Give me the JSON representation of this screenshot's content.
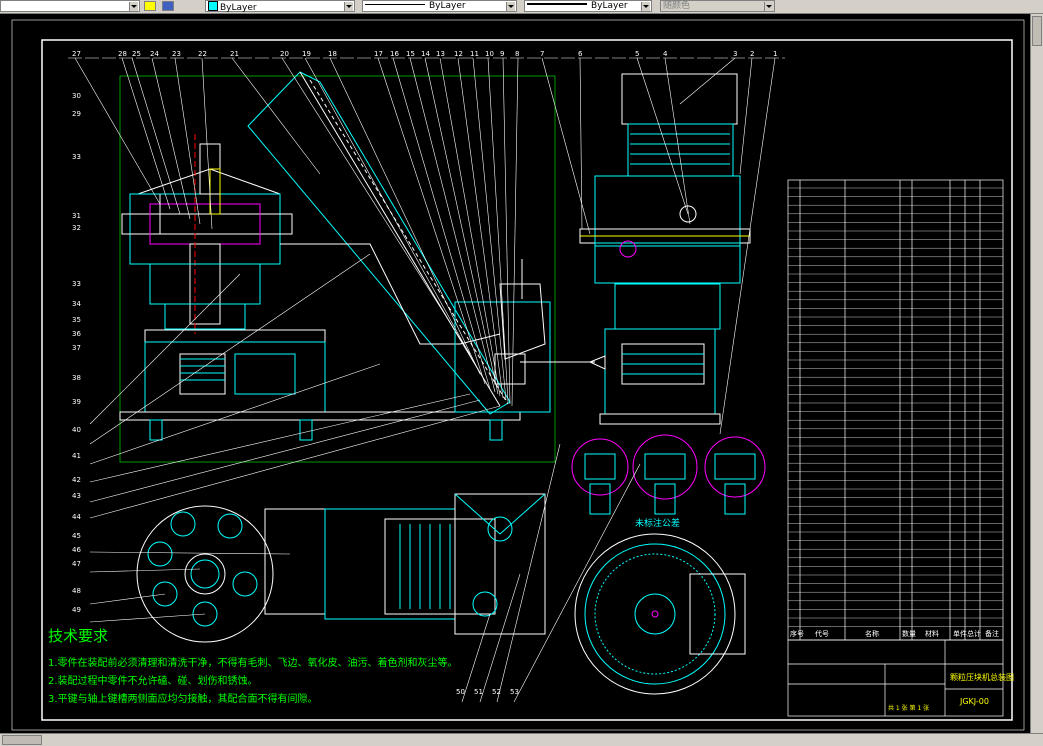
{
  "toolbar": {
    "layer_color_label": "ByLayer",
    "linetype_label": "ByLayer",
    "lineweight_label": "ByLayer",
    "plot_style_label": "随颜色"
  },
  "drawing": {
    "tech_title": "技术要求",
    "tech_lines": [
      "1.零件在装配前必须清理和清洗干净，不得有毛刺、飞边、氧化皮、油污、着色剂和灰尘等。",
      "2.装配过程中零件不允许磕、碰、划伤和锈蚀。",
      "3.平键与轴上键槽两侧面应均匀接触，其配合面不得有间隙。"
    ],
    "balloons_top": [
      "27",
      "28",
      "25",
      "24",
      "23",
      "22",
      "21",
      "20",
      "19",
      "18",
      "17",
      "16",
      "15",
      "14",
      "13",
      "12",
      "11",
      "10",
      "9",
      "8",
      "7",
      "6",
      "5",
      "4",
      "3",
      "2",
      "1"
    ],
    "balloons_left": [
      "30",
      "29",
      "33",
      "31",
      "32",
      "33",
      "34",
      "35",
      "36",
      "37",
      "38",
      "39",
      "40",
      "41",
      "42",
      "43",
      "44",
      "45",
      "46",
      "47",
      "48",
      "49"
    ],
    "balloons_bottom": [
      "50",
      "51",
      "52",
      "53"
    ],
    "detail_label": "未标注公差",
    "title_block": {
      "name": "颗粒压块机总装图",
      "code": "JGKJ-00",
      "sheet": "共 1 张  第 1 张"
    },
    "bom_header": [
      "序号",
      "代号",
      "名称",
      "数量",
      "材料",
      "单件",
      "总计",
      "备注"
    ]
  },
  "colors": {
    "drawing_cyan": "#00ffff",
    "drawing_white": "#ffffff",
    "drawing_yellow": "#ffff00",
    "drawing_green": "#00ff00",
    "drawing_magenta": "#ff00ff",
    "drawing_red": "#ff0000"
  },
  "icons": [
    "layer-state-icon",
    "layer-manager-icon",
    "dropdown-arrow-icon"
  ]
}
